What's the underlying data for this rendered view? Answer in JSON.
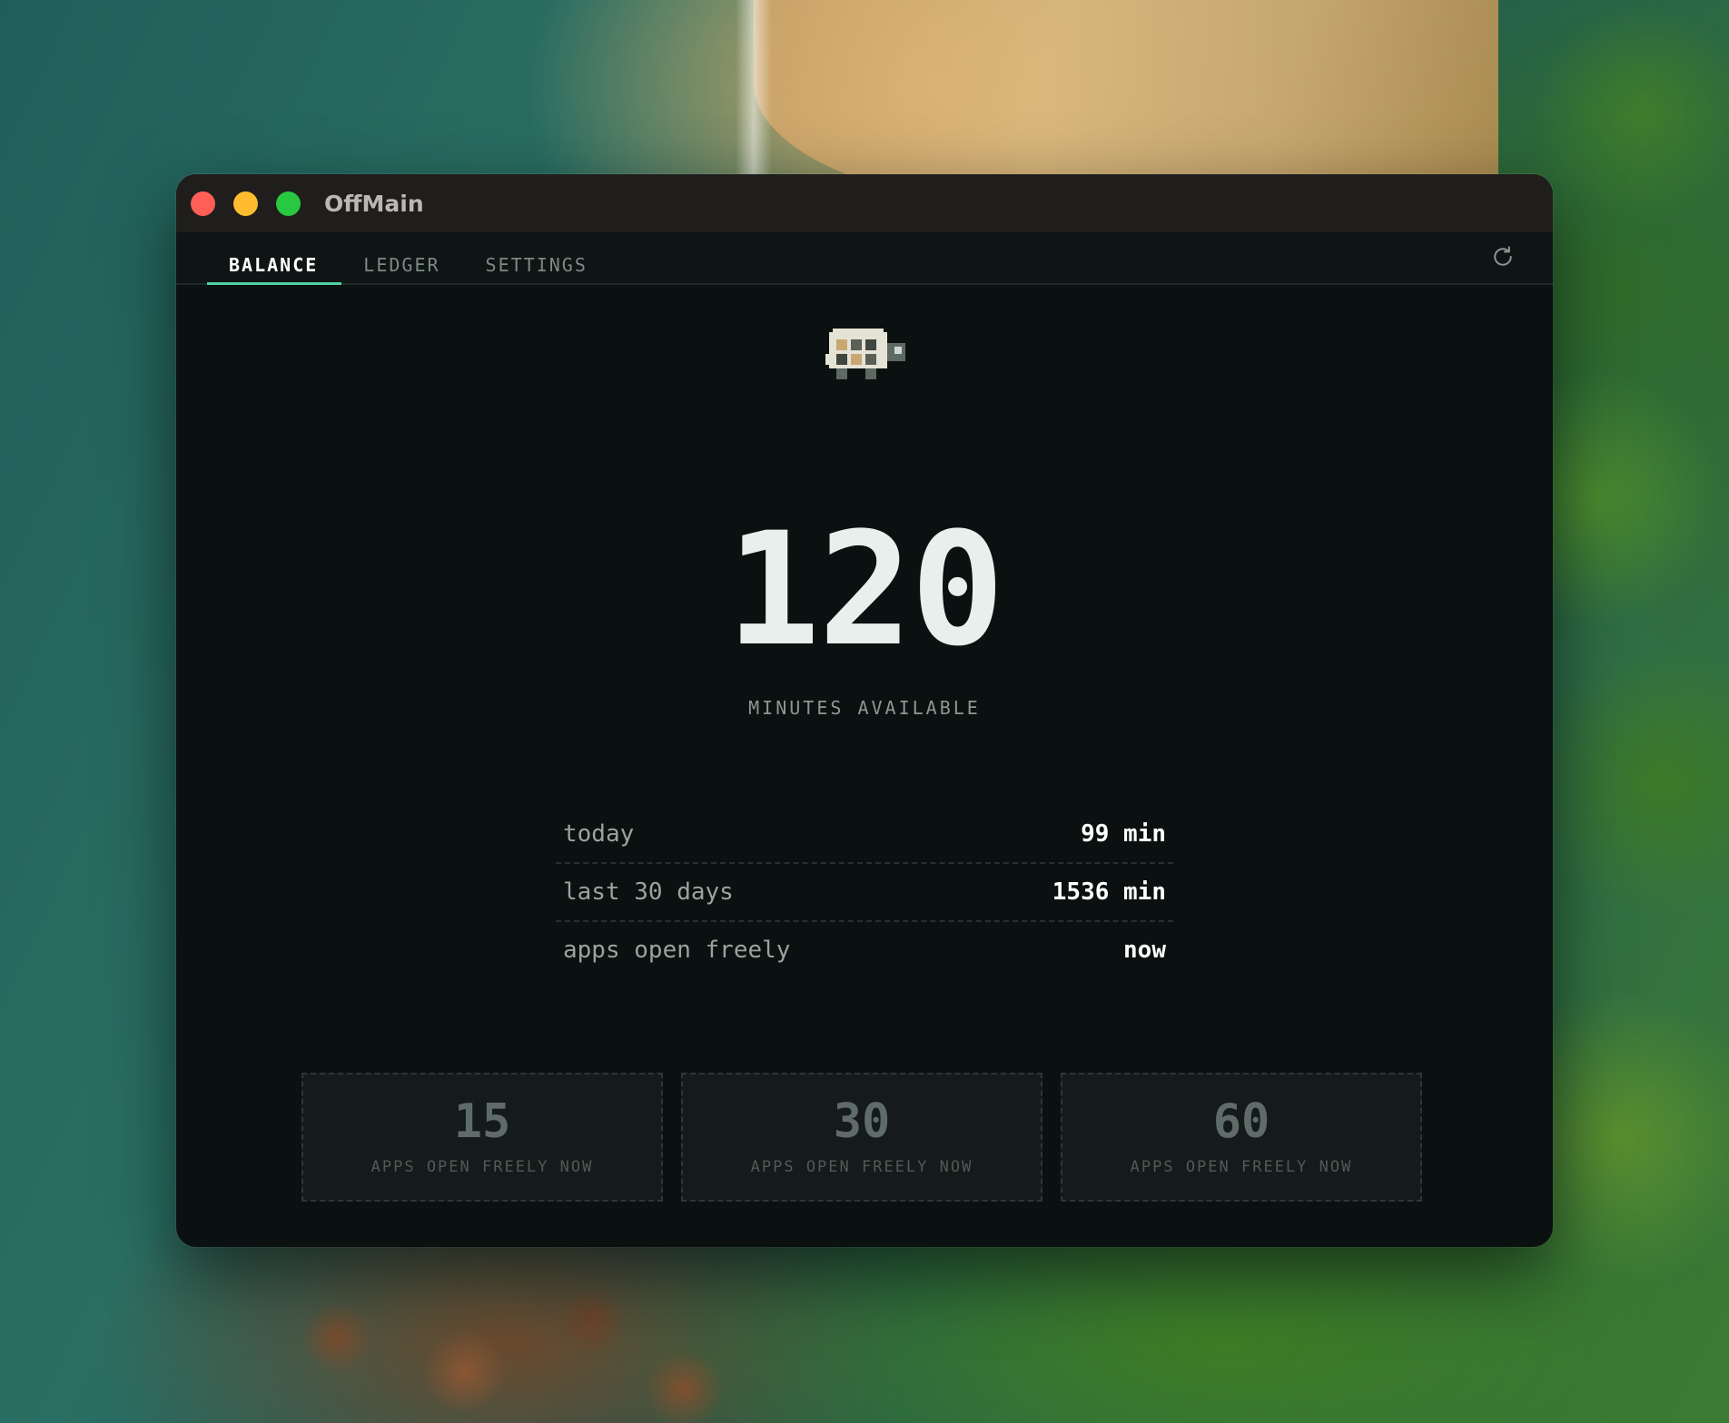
{
  "window": {
    "title": "OffMain"
  },
  "tabs": [
    {
      "label": "BALANCE",
      "active": true
    },
    {
      "label": "LEDGER",
      "active": false
    },
    {
      "label": "SETTINGS",
      "active": false
    }
  ],
  "toolbar": {
    "refresh_icon": "refresh-icon"
  },
  "mascot": {
    "icon": "turtle-icon"
  },
  "balance": {
    "value": "120",
    "label": "MINUTES AVAILABLE"
  },
  "stats": [
    {
      "label": "today",
      "value": "99 min"
    },
    {
      "label": "last 30 days",
      "value": "1536 min"
    },
    {
      "label": "apps open freely",
      "value": "now"
    }
  ],
  "spend_buttons": [
    {
      "amount": "15",
      "label": "APPS OPEN FREELY NOW"
    },
    {
      "amount": "30",
      "label": "APPS OPEN FREELY NOW"
    },
    {
      "amount": "60",
      "label": "APPS OPEN FREELY NOW"
    }
  ],
  "colors": {
    "accent": "#4fd1a5",
    "background": "#0b1110",
    "titlebar": "#1f1e1c"
  }
}
